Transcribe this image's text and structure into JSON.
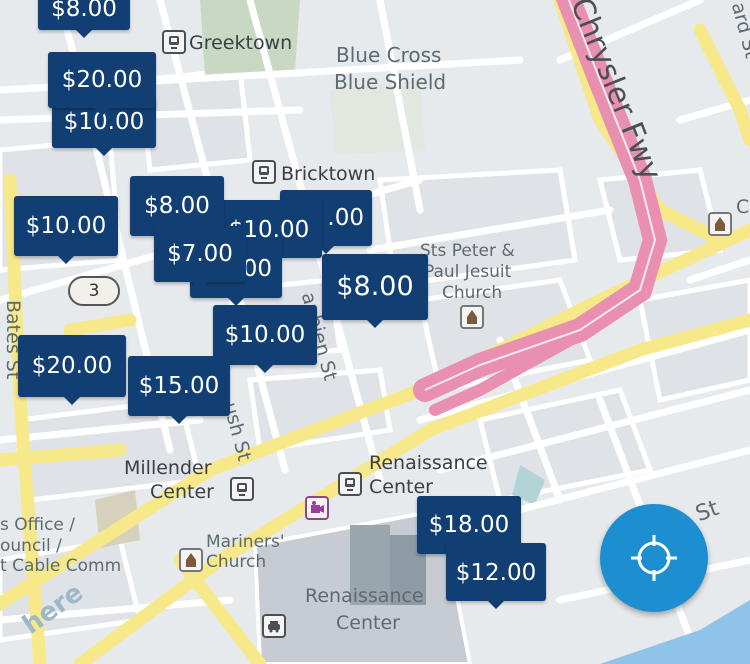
{
  "labels": {
    "greektown": "Greektown",
    "blue_cross_1": "Blue Cross",
    "blue_cross_2": "Blue Shield",
    "bricktown": "Bricktown",
    "church_1": "Sts Peter &",
    "church_2": "Paul Jesuit",
    "church_3": "Church",
    "millender_1": "Millender",
    "millender_2": "Center",
    "renaissance_1": "Renaissance",
    "renaissance_2": "Center",
    "mariners_1": "Mariners'",
    "mariners_2": "Church",
    "ren_bottom_1": "Renaissance",
    "ren_bottom_2": "Center",
    "office_1": "s Office /",
    "office_2": "ouncil /",
    "office_3": "t Cable Comm",
    "chrysler": "Chrysler  Fwy",
    "bates": "Bates St",
    "brush": "ush St",
    "beaubien": "aubien St",
    "st_right": "St",
    "st_top_right": "ard St",
    "edge_c": "C",
    "route_3": "3",
    "here_logo": "here"
  },
  "pins": [
    {
      "id": "pin-top-8",
      "price": "$8.00"
    },
    {
      "id": "pin-20a",
      "price": "$20.00"
    },
    {
      "id": "pin-10a",
      "price": "$10.00"
    },
    {
      "id": "pin-8b",
      "price": "$8.00"
    },
    {
      "id": "pin-10b",
      "price": "$10.00"
    },
    {
      "id": "pin-10c",
      "price": "$10.00"
    },
    {
      "id": "pin-00a",
      "price": ".00"
    },
    {
      "id": "pin-7",
      "price": "$7.00"
    },
    {
      "id": "pin-00b",
      "price": "00"
    },
    {
      "id": "pin-8c",
      "price": "$8.00"
    },
    {
      "id": "pin-10d",
      "price": "$10.00"
    },
    {
      "id": "pin-20b",
      "price": "$20.00"
    },
    {
      "id": "pin-15",
      "price": "$15.00"
    },
    {
      "id": "pin-18",
      "price": "$18.00"
    },
    {
      "id": "pin-12",
      "price": "$12.00"
    }
  ],
  "locate_button": {
    "icon": "crosshair-icon"
  },
  "colors": {
    "pin_bg": "#123f73",
    "freeway": "#e98fb0",
    "arterial": "#f7e88a",
    "locate_bg": "#1d8fd1"
  }
}
